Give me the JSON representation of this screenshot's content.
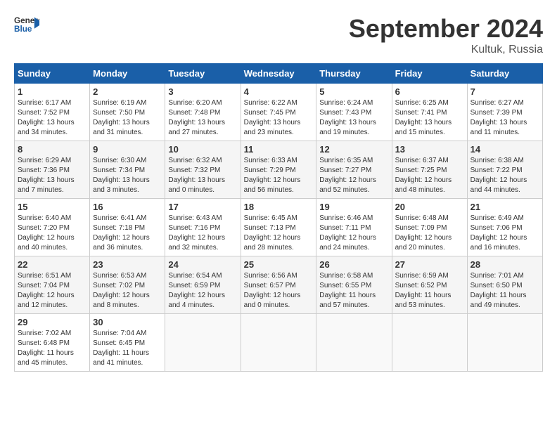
{
  "logo": {
    "text_general": "General",
    "text_blue": "Blue"
  },
  "title": "September 2024",
  "location": "Kultuk, Russia",
  "days_of_week": [
    "Sunday",
    "Monday",
    "Tuesday",
    "Wednesday",
    "Thursday",
    "Friday",
    "Saturday"
  ],
  "weeks": [
    [
      {
        "day": "1",
        "sunrise": "Sunrise: 6:17 AM",
        "sunset": "Sunset: 7:52 PM",
        "daylight": "Daylight: 13 hours and 34 minutes."
      },
      {
        "day": "2",
        "sunrise": "Sunrise: 6:19 AM",
        "sunset": "Sunset: 7:50 PM",
        "daylight": "Daylight: 13 hours and 31 minutes."
      },
      {
        "day": "3",
        "sunrise": "Sunrise: 6:20 AM",
        "sunset": "Sunset: 7:48 PM",
        "daylight": "Daylight: 13 hours and 27 minutes."
      },
      {
        "day": "4",
        "sunrise": "Sunrise: 6:22 AM",
        "sunset": "Sunset: 7:45 PM",
        "daylight": "Daylight: 13 hours and 23 minutes."
      },
      {
        "day": "5",
        "sunrise": "Sunrise: 6:24 AM",
        "sunset": "Sunset: 7:43 PM",
        "daylight": "Daylight: 13 hours and 19 minutes."
      },
      {
        "day": "6",
        "sunrise": "Sunrise: 6:25 AM",
        "sunset": "Sunset: 7:41 PM",
        "daylight": "Daylight: 13 hours and 15 minutes."
      },
      {
        "day": "7",
        "sunrise": "Sunrise: 6:27 AM",
        "sunset": "Sunset: 7:39 PM",
        "daylight": "Daylight: 13 hours and 11 minutes."
      }
    ],
    [
      {
        "day": "8",
        "sunrise": "Sunrise: 6:29 AM",
        "sunset": "Sunset: 7:36 PM",
        "daylight": "Daylight: 13 hours and 7 minutes."
      },
      {
        "day": "9",
        "sunrise": "Sunrise: 6:30 AM",
        "sunset": "Sunset: 7:34 PM",
        "daylight": "Daylight: 13 hours and 3 minutes."
      },
      {
        "day": "10",
        "sunrise": "Sunrise: 6:32 AM",
        "sunset": "Sunset: 7:32 PM",
        "daylight": "Daylight: 13 hours and 0 minutes."
      },
      {
        "day": "11",
        "sunrise": "Sunrise: 6:33 AM",
        "sunset": "Sunset: 7:29 PM",
        "daylight": "Daylight: 12 hours and 56 minutes."
      },
      {
        "day": "12",
        "sunrise": "Sunrise: 6:35 AM",
        "sunset": "Sunset: 7:27 PM",
        "daylight": "Daylight: 12 hours and 52 minutes."
      },
      {
        "day": "13",
        "sunrise": "Sunrise: 6:37 AM",
        "sunset": "Sunset: 7:25 PM",
        "daylight": "Daylight: 12 hours and 48 minutes."
      },
      {
        "day": "14",
        "sunrise": "Sunrise: 6:38 AM",
        "sunset": "Sunset: 7:22 PM",
        "daylight": "Daylight: 12 hours and 44 minutes."
      }
    ],
    [
      {
        "day": "15",
        "sunrise": "Sunrise: 6:40 AM",
        "sunset": "Sunset: 7:20 PM",
        "daylight": "Daylight: 12 hours and 40 minutes."
      },
      {
        "day": "16",
        "sunrise": "Sunrise: 6:41 AM",
        "sunset": "Sunset: 7:18 PM",
        "daylight": "Daylight: 12 hours and 36 minutes."
      },
      {
        "day": "17",
        "sunrise": "Sunrise: 6:43 AM",
        "sunset": "Sunset: 7:16 PM",
        "daylight": "Daylight: 12 hours and 32 minutes."
      },
      {
        "day": "18",
        "sunrise": "Sunrise: 6:45 AM",
        "sunset": "Sunset: 7:13 PM",
        "daylight": "Daylight: 12 hours and 28 minutes."
      },
      {
        "day": "19",
        "sunrise": "Sunrise: 6:46 AM",
        "sunset": "Sunset: 7:11 PM",
        "daylight": "Daylight: 12 hours and 24 minutes."
      },
      {
        "day": "20",
        "sunrise": "Sunrise: 6:48 AM",
        "sunset": "Sunset: 7:09 PM",
        "daylight": "Daylight: 12 hours and 20 minutes."
      },
      {
        "day": "21",
        "sunrise": "Sunrise: 6:49 AM",
        "sunset": "Sunset: 7:06 PM",
        "daylight": "Daylight: 12 hours and 16 minutes."
      }
    ],
    [
      {
        "day": "22",
        "sunrise": "Sunrise: 6:51 AM",
        "sunset": "Sunset: 7:04 PM",
        "daylight": "Daylight: 12 hours and 12 minutes."
      },
      {
        "day": "23",
        "sunrise": "Sunrise: 6:53 AM",
        "sunset": "Sunset: 7:02 PM",
        "daylight": "Daylight: 12 hours and 8 minutes."
      },
      {
        "day": "24",
        "sunrise": "Sunrise: 6:54 AM",
        "sunset": "Sunset: 6:59 PM",
        "daylight": "Daylight: 12 hours and 4 minutes."
      },
      {
        "day": "25",
        "sunrise": "Sunrise: 6:56 AM",
        "sunset": "Sunset: 6:57 PM",
        "daylight": "Daylight: 12 hours and 0 minutes."
      },
      {
        "day": "26",
        "sunrise": "Sunrise: 6:58 AM",
        "sunset": "Sunset: 6:55 PM",
        "daylight": "Daylight: 11 hours and 57 minutes."
      },
      {
        "day": "27",
        "sunrise": "Sunrise: 6:59 AM",
        "sunset": "Sunset: 6:52 PM",
        "daylight": "Daylight: 11 hours and 53 minutes."
      },
      {
        "day": "28",
        "sunrise": "Sunrise: 7:01 AM",
        "sunset": "Sunset: 6:50 PM",
        "daylight": "Daylight: 11 hours and 49 minutes."
      }
    ],
    [
      {
        "day": "29",
        "sunrise": "Sunrise: 7:02 AM",
        "sunset": "Sunset: 6:48 PM",
        "daylight": "Daylight: 11 hours and 45 minutes."
      },
      {
        "day": "30",
        "sunrise": "Sunrise: 7:04 AM",
        "sunset": "Sunset: 6:45 PM",
        "daylight": "Daylight: 11 hours and 41 minutes."
      },
      null,
      null,
      null,
      null,
      null
    ]
  ]
}
